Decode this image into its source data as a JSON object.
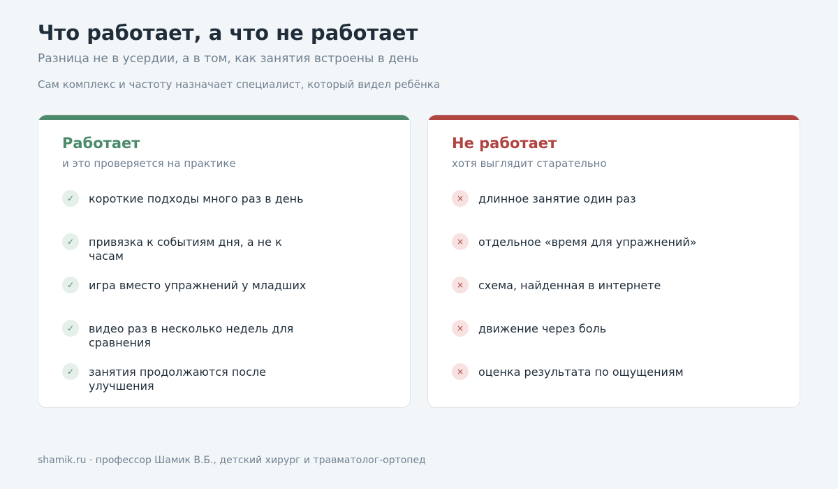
{
  "header": {
    "title": "Что работает, а что не работает",
    "subtitle": "Разница не в усердии, а в том, как занятия встроены в день",
    "note": "Сам комплекс и частоту назначает специалист, который видел ребёнка"
  },
  "works": {
    "title": "Работает",
    "subtitle": "и это проверяется на практике",
    "icon": "✓",
    "items": [
      "короткие подходы много раз в день",
      "привязка к событиям дня, а не к часам",
      "игра вместо упражнений у младших",
      "видео раз в несколько недель для сравнения",
      "занятия продолжаются после улучшения"
    ]
  },
  "fails": {
    "title": "Не работает",
    "subtitle": "хотя выглядит старательно",
    "icon": "×",
    "items": [
      "длинное занятие один раз",
      "отдельное «время для упражнений»",
      "схема, найденная в интернете",
      "движение через боль",
      "оценка результата по ощущениям"
    ]
  },
  "footer": {
    "text": "shamik.ru · профессор Шамик В.Б., детский хирург и травматолог-ортопед"
  },
  "colors": {
    "works_accent": "#4c8a6b",
    "fails_accent": "#b04440",
    "background": "#f3f6f9"
  }
}
